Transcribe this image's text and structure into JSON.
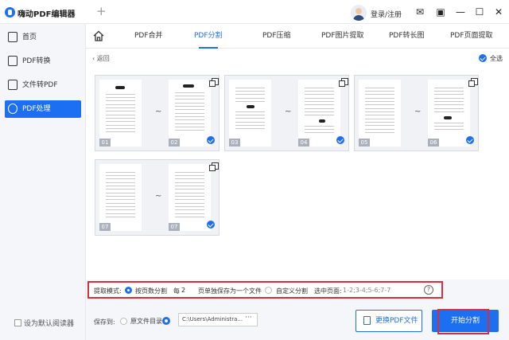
{
  "app": {
    "title": "嗨动PDF编辑器",
    "new_tab": "+",
    "login": "登录/注册"
  },
  "window_controls": [
    "✉",
    "▣",
    "—",
    "☐",
    "✕"
  ],
  "sidebar": {
    "items": [
      {
        "label": "首页",
        "icon": "home-icon"
      },
      {
        "label": "PDF转换",
        "icon": "convert-icon"
      },
      {
        "label": "文件转PDF",
        "icon": "file-icon"
      },
      {
        "label": "PDF处理",
        "icon": "process-icon",
        "active": true
      }
    ],
    "default_reader": "设为默认阅读器"
  },
  "tabs": [
    {
      "label": "PDF合并"
    },
    {
      "label": "PDF分割",
      "active": true
    },
    {
      "label": "PDF压缩"
    },
    {
      "label": "PDF图片提取"
    },
    {
      "label": "PDF转长图"
    },
    {
      "label": "PDF页面提取"
    }
  ],
  "content": {
    "back": "返回",
    "select_all": "全选",
    "range_sep": "~",
    "cards": [
      {
        "from": "01",
        "to": "02",
        "checked": true
      },
      {
        "from": "03",
        "to": "04",
        "checked": true
      },
      {
        "from": "05",
        "to": "06",
        "checked": true
      },
      {
        "from": "07",
        "to": "07",
        "checked": true
      }
    ]
  },
  "mode": {
    "label": "提取模式:",
    "by_pages": "按页数分割",
    "every": "每",
    "count": "2",
    "per_file": "页单独保存为一个文件",
    "custom": "自定义分割",
    "selected_label": "选中页面:",
    "selected_value": "1-2;3-4;5-6;7-7",
    "help": "?"
  },
  "save": {
    "label": "保存到:",
    "source_dir": "原文件目录",
    "path": "C:\\Users\\Administra...",
    "browse": "···"
  },
  "buttons": {
    "change_file": "更换PDF文件",
    "start": "开始分割"
  },
  "colors": {
    "accent": "#1d6ff2",
    "highlight": "#d62f3a"
  }
}
